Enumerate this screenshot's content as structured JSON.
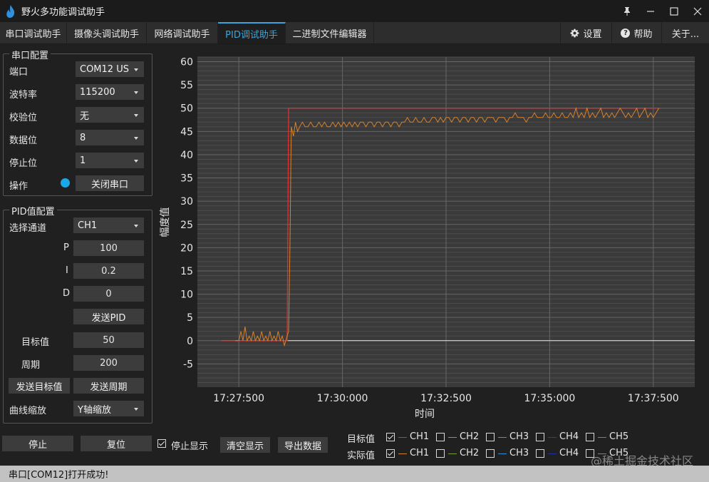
{
  "window": {
    "title": "野火多功能调试助手"
  },
  "tabs": [
    "串口调试助手",
    "摄像头调试助手",
    "网络调试助手",
    "PID调试助手",
    "二进制文件编辑器"
  ],
  "active_tab": 3,
  "right_tabs": {
    "settings": "设置",
    "help": "帮助",
    "about": "关于..."
  },
  "serial": {
    "group_title": "串口配置",
    "port_label": "端口",
    "port_value": "COM12 US",
    "baud_label": "波特率",
    "baud_value": "115200",
    "parity_label": "校验位",
    "parity_value": "无",
    "databits_label": "数据位",
    "databits_value": "8",
    "stopbits_label": "停止位",
    "stopbits_value": "1",
    "op_label": "操作",
    "close_button": "关闭串口"
  },
  "pid": {
    "group_title": "PID值配置",
    "channel_label": "选择通道",
    "channel_value": "CH1",
    "p_label": "P",
    "p_value": "100",
    "i_label": "I",
    "i_value": "0.2",
    "d_label": "D",
    "d_value": "0",
    "send_pid_button": "发送PID",
    "target_label": "目标值",
    "target_value": "50",
    "period_label": "周期",
    "period_value": "200",
    "send_target_button": "发送目标值",
    "send_period_button": "发送周期",
    "zoom_label": "曲线缩放",
    "zoom_value": "Y轴缩放"
  },
  "bottom": {
    "stop_button": "停止",
    "reset_button": "复位",
    "stop_display_label": "停止显示",
    "clear_button": "清空显示",
    "export_button": "导出数据"
  },
  "legend": {
    "target_label": "目标值",
    "actual_label": "实际值",
    "target_channels": [
      {
        "name": "CH1",
        "checked": true,
        "color": "#e03030"
      },
      {
        "name": "CH2",
        "checked": false,
        "color": "#9a9a30"
      },
      {
        "name": "CH3",
        "checked": false,
        "color": "#20b0b0"
      },
      {
        "name": "CH4",
        "checked": false,
        "color": "#2a4a6a"
      },
      {
        "name": "CH5",
        "checked": false,
        "color": "#a060c0"
      }
    ],
    "actual_channels": [
      {
        "name": "CH1",
        "checked": true,
        "color": "#d08030"
      },
      {
        "name": "CH2",
        "checked": false,
        "color": "#70a030"
      },
      {
        "name": "CH3",
        "checked": false,
        "color": "#3090d0"
      },
      {
        "name": "CH4",
        "checked": false,
        "color": "#2030a0"
      },
      {
        "name": "CH5",
        "checked": false,
        "color": "#808080"
      }
    ]
  },
  "status": {
    "message": "串口[COM12]打开成功!"
  },
  "watermark": "@稀土掘金技术社区",
  "chart_data": {
    "type": "line",
    "xlabel": "时间",
    "ylabel": "幅度值",
    "x_tick_labels": [
      "17:27:500",
      "17:30:000",
      "17:32:500",
      "17:35:000",
      "17:37:500"
    ],
    "x_ticks_sec": [
      0,
      150,
      300,
      450,
      600
    ],
    "xlim_sec": [
      -60,
      660
    ],
    "y_ticks": [
      60,
      55,
      50,
      45,
      40,
      35,
      30,
      25,
      20,
      15,
      10,
      5,
      0,
      -5
    ],
    "ylim": [
      -10,
      61
    ],
    "grid": true,
    "series": [
      {
        "name": "目标值 CH1",
        "color": "#e03030",
        "points": [
          [
            -25,
            0
          ],
          [
            70,
            0
          ],
          [
            72,
            50
          ],
          [
            610,
            50
          ]
        ]
      },
      {
        "name": "实际值 CH1",
        "color": "#d9822b",
        "points": [
          [
            -5,
            0
          ],
          [
            0,
            0
          ],
          [
            3,
            2
          ],
          [
            6,
            0
          ],
          [
            9,
            3
          ],
          [
            12,
            0
          ],
          [
            15,
            1
          ],
          [
            18,
            0
          ],
          [
            21,
            2
          ],
          [
            24,
            0
          ],
          [
            27,
            1
          ],
          [
            30,
            0
          ],
          [
            33,
            2
          ],
          [
            36,
            0
          ],
          [
            39,
            1
          ],
          [
            42,
            0
          ],
          [
            45,
            2
          ],
          [
            48,
            0
          ],
          [
            51,
            1
          ],
          [
            54,
            0
          ],
          [
            57,
            2
          ],
          [
            60,
            0
          ],
          [
            63,
            1
          ],
          [
            66,
            -1
          ],
          [
            68,
            0
          ],
          [
            70,
            1
          ],
          [
            72,
            2
          ],
          [
            74,
            20
          ],
          [
            76,
            46
          ],
          [
            79,
            44
          ],
          [
            82,
            47
          ],
          [
            85,
            45
          ],
          [
            88,
            46
          ],
          [
            92,
            47
          ],
          [
            96,
            46
          ],
          [
            100,
            46
          ],
          [
            104,
            47
          ],
          [
            108,
            46
          ],
          [
            112,
            46
          ],
          [
            116,
            47
          ],
          [
            120,
            46
          ],
          [
            124,
            47
          ],
          [
            128,
            46
          ],
          [
            132,
            46
          ],
          [
            136,
            47
          ],
          [
            140,
            46
          ],
          [
            144,
            47
          ],
          [
            148,
            46
          ],
          [
            152,
            47
          ],
          [
            156,
            46
          ],
          [
            160,
            47
          ],
          [
            164,
            46
          ],
          [
            168,
            47
          ],
          [
            172,
            46
          ],
          [
            176,
            47
          ],
          [
            180,
            47
          ],
          [
            184,
            46
          ],
          [
            188,
            47
          ],
          [
            192,
            47
          ],
          [
            196,
            46
          ],
          [
            200,
            47
          ],
          [
            204,
            47
          ],
          [
            208,
            46
          ],
          [
            212,
            47
          ],
          [
            216,
            47
          ],
          [
            220,
            46
          ],
          [
            224,
            47
          ],
          [
            228,
            47
          ],
          [
            232,
            46
          ],
          [
            236,
            47
          ],
          [
            240,
            47
          ],
          [
            244,
            48
          ],
          [
            248,
            47
          ],
          [
            252,
            47
          ],
          [
            256,
            48
          ],
          [
            260,
            47
          ],
          [
            264,
            47
          ],
          [
            268,
            48
          ],
          [
            272,
            47
          ],
          [
            276,
            47
          ],
          [
            280,
            48
          ],
          [
            284,
            48
          ],
          [
            288,
            47
          ],
          [
            292,
            48
          ],
          [
            296,
            47
          ],
          [
            300,
            48
          ],
          [
            304,
            48
          ],
          [
            308,
            47
          ],
          [
            312,
            48
          ],
          [
            316,
            48
          ],
          [
            320,
            47
          ],
          [
            324,
            48
          ],
          [
            328,
            48
          ],
          [
            332,
            47
          ],
          [
            336,
            48
          ],
          [
            340,
            48
          ],
          [
            344,
            47
          ],
          [
            348,
            48
          ],
          [
            352,
            48
          ],
          [
            356,
            47
          ],
          [
            360,
            48
          ],
          [
            364,
            48
          ],
          [
            368,
            48
          ],
          [
            372,
            47
          ],
          [
            376,
            48
          ],
          [
            380,
            48
          ],
          [
            384,
            48
          ],
          [
            388,
            47
          ],
          [
            392,
            48
          ],
          [
            396,
            48
          ],
          [
            400,
            49
          ],
          [
            404,
            48
          ],
          [
            408,
            48
          ],
          [
            412,
            48
          ],
          [
            416,
            47
          ],
          [
            420,
            48
          ],
          [
            424,
            48
          ],
          [
            428,
            49
          ],
          [
            432,
            48
          ],
          [
            436,
            48
          ],
          [
            440,
            48
          ],
          [
            444,
            49
          ],
          [
            448,
            48
          ],
          [
            452,
            48
          ],
          [
            456,
            49
          ],
          [
            460,
            48
          ],
          [
            464,
            48
          ],
          [
            468,
            49
          ],
          [
            472,
            48
          ],
          [
            476,
            48
          ],
          [
            480,
            49
          ],
          [
            484,
            48
          ],
          [
            488,
            50
          ],
          [
            492,
            48
          ],
          [
            496,
            49
          ],
          [
            500,
            48
          ],
          [
            504,
            50
          ],
          [
            508,
            48
          ],
          [
            512,
            49
          ],
          [
            516,
            48
          ],
          [
            520,
            49
          ],
          [
            524,
            50
          ],
          [
            528,
            48
          ],
          [
            532,
            49
          ],
          [
            536,
            48
          ],
          [
            540,
            49
          ],
          [
            544,
            48
          ],
          [
            548,
            49
          ],
          [
            552,
            50
          ],
          [
            556,
            49
          ],
          [
            560,
            48
          ],
          [
            564,
            49
          ],
          [
            568,
            48
          ],
          [
            572,
            49
          ],
          [
            576,
            50
          ],
          [
            580,
            48
          ],
          [
            584,
            49
          ],
          [
            588,
            50
          ],
          [
            592,
            48
          ],
          [
            596,
            49
          ],
          [
            600,
            48
          ],
          [
            604,
            49
          ],
          [
            608,
            50
          ]
        ]
      }
    ]
  }
}
